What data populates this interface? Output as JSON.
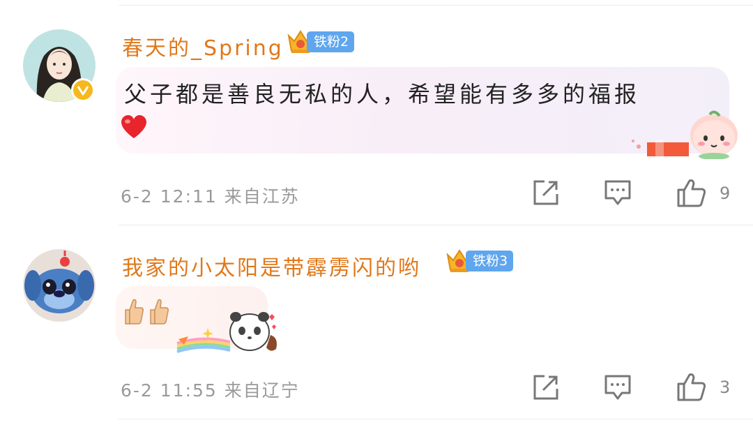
{
  "comments": [
    {
      "username": "春天的_Spring",
      "fan_badge": "铁粉2",
      "text": "父子都是善良无私的人，希望能有多多的福报",
      "emoji": "heart",
      "time": "6-2 12:11 来自江苏",
      "likes": "9"
    },
    {
      "username": "我家的小太阳是带霹雳闪的哟",
      "fan_badge": "铁粉3",
      "emoji": "thumbs-up",
      "time": "6-2 11:55 来自辽宁",
      "likes": "3"
    }
  ],
  "colors": {
    "username": "#e0781a",
    "fan_badge": "#5fa6ee",
    "verified": "#f6b81c",
    "meta": "#9a9a9a"
  }
}
